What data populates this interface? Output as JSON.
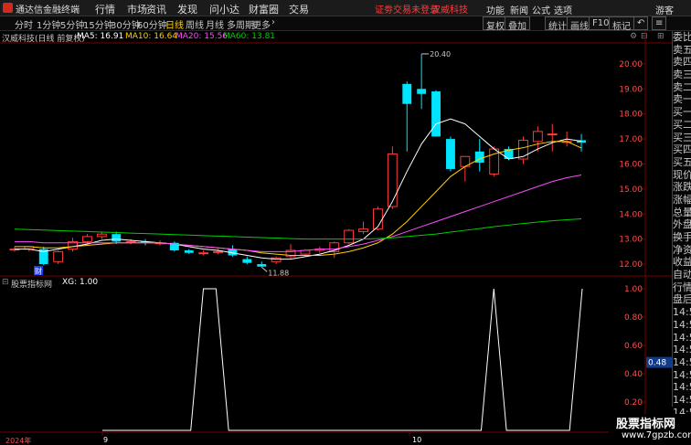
{
  "menubar": {
    "app_title": "通达信金融终端",
    "items": [
      "行情",
      "市场",
      "资讯",
      "发现",
      "问小达",
      "财富圈",
      "交易"
    ],
    "notice": "证劵交易未登录",
    "stock": "汉威科技",
    "right_items": [
      "功能",
      "新闻",
      "公式",
      "选项",
      "游客"
    ]
  },
  "periodbar": {
    "periods": [
      "分时",
      "1分钟",
      "5分钟",
      "15分钟",
      "30分钟",
      "60分钟",
      "日线",
      "周线",
      "月线",
      "多周期",
      "更多"
    ],
    "active": "日线",
    "tools": [
      "复权",
      "叠加",
      "统计",
      "画线",
      "F10",
      "标记"
    ]
  },
  "main_info": {
    "title": "汉威科技(日线 前复权)",
    "ma5": "MA5: 16.91",
    "ma10": "MA10: 16.64",
    "ma20": "MA20: 15.56",
    "ma60": "MA60: 13.81"
  },
  "sub_info": {
    "title": "股票指标网",
    "xg": "XG: 1.00"
  },
  "annotations": {
    "high": "20.40",
    "low": "11.88",
    "cai_badge": "财"
  },
  "dates": [
    "2024年",
    "9",
    "10"
  ],
  "right_panel": [
    "委比",
    "卖五",
    "卖四",
    "卖三",
    "卖二",
    "卖一",
    "买一",
    "买二",
    "买三",
    "买四",
    "买五",
    "现价",
    "涨跌",
    "涨幅",
    "总量",
    "外盘",
    "换手",
    "净资",
    "收益",
    "自动",
    "行情",
    "盘后",
    "14:5",
    "14:5",
    "14:5",
    "14:5",
    "14:5",
    "14:5",
    "14:5",
    "14:5",
    "14:5"
  ],
  "watermark": {
    "title": "股票指标网",
    "url": "www.7gpzb.com"
  },
  "colors": {
    "up": "#ff3b3b",
    "down": "#00e5ff",
    "ma5": "#ffffff",
    "ma10": "#ffd000",
    "ma20": "#ff4bff",
    "ma60": "#00d000"
  },
  "chart_data": [
    {
      "type": "candlestick",
      "title": "汉威科技(日线 前复权)",
      "y_ticks": [
        12.0,
        13.0,
        14.0,
        15.0,
        16.0,
        17.0,
        18.0,
        19.0,
        20.0
      ],
      "ylim": [
        11.6,
        20.8
      ],
      "candles": [
        {
          "o": 12.6,
          "h": 12.7,
          "l": 12.5,
          "c": 12.6
        },
        {
          "o": 12.6,
          "h": 12.7,
          "l": 12.5,
          "c": 12.7
        },
        {
          "o": 12.6,
          "h": 12.7,
          "l": 11.95,
          "c": 12.0
        },
        {
          "o": 12.1,
          "h": 12.55,
          "l": 12.0,
          "c": 12.5
        },
        {
          "o": 12.6,
          "h": 13.05,
          "l": 12.5,
          "c": 12.9
        },
        {
          "o": 12.9,
          "h": 13.2,
          "l": 12.8,
          "c": 13.1
        },
        {
          "o": 13.1,
          "h": 13.3,
          "l": 13.0,
          "c": 13.2
        },
        {
          "o": 13.2,
          "h": 13.3,
          "l": 12.8,
          "c": 12.9
        },
        {
          "o": 12.9,
          "h": 13.0,
          "l": 12.8,
          "c": 12.9
        },
        {
          "o": 12.9,
          "h": 13.0,
          "l": 12.75,
          "c": 12.85
        },
        {
          "o": 12.85,
          "h": 12.95,
          "l": 12.75,
          "c": 12.85
        },
        {
          "o": 12.85,
          "h": 12.9,
          "l": 12.5,
          "c": 12.55
        },
        {
          "o": 12.55,
          "h": 12.6,
          "l": 12.4,
          "c": 12.45
        },
        {
          "o": 12.45,
          "h": 12.55,
          "l": 12.35,
          "c": 12.45
        },
        {
          "o": 12.5,
          "h": 12.6,
          "l": 12.4,
          "c": 12.5
        },
        {
          "o": 12.6,
          "h": 12.75,
          "l": 12.3,
          "c": 12.35
        },
        {
          "o": 12.2,
          "h": 12.3,
          "l": 12.0,
          "c": 12.05
        },
        {
          "o": 12.0,
          "h": 12.1,
          "l": 11.88,
          "c": 11.9
        },
        {
          "o": 12.1,
          "h": 12.3,
          "l": 12.0,
          "c": 12.25
        },
        {
          "o": 12.3,
          "h": 12.8,
          "l": 12.2,
          "c": 12.55
        },
        {
          "o": 12.4,
          "h": 12.6,
          "l": 12.3,
          "c": 12.55
        },
        {
          "o": 12.55,
          "h": 12.7,
          "l": 12.45,
          "c": 12.6
        },
        {
          "o": 12.5,
          "h": 12.9,
          "l": 12.25,
          "c": 12.85
        },
        {
          "o": 12.85,
          "h": 13.4,
          "l": 12.8,
          "c": 13.35
        },
        {
          "o": 13.3,
          "h": 13.7,
          "l": 13.2,
          "c": 13.4
        },
        {
          "o": 13.4,
          "h": 14.3,
          "l": 13.35,
          "c": 14.2
        },
        {
          "o": 14.3,
          "h": 16.7,
          "l": 14.2,
          "c": 16.4
        },
        {
          "o": 19.2,
          "h": 19.3,
          "l": 16.5,
          "c": 18.4
        },
        {
          "o": 19.0,
          "h": 20.4,
          "l": 18.2,
          "c": 18.8
        },
        {
          "o": 18.9,
          "h": 18.95,
          "l": 17.1,
          "c": 17.1
        },
        {
          "o": 17.0,
          "h": 17.1,
          "l": 15.7,
          "c": 15.8
        },
        {
          "o": 15.9,
          "h": 16.3,
          "l": 15.3,
          "c": 16.3
        },
        {
          "o": 16.5,
          "h": 17.0,
          "l": 15.7,
          "c": 16.05
        },
        {
          "o": 15.6,
          "h": 16.7,
          "l": 15.5,
          "c": 16.6
        },
        {
          "o": 16.6,
          "h": 16.7,
          "l": 16.15,
          "c": 16.2
        },
        {
          "o": 16.2,
          "h": 17.1,
          "l": 16.0,
          "c": 16.95
        },
        {
          "o": 16.9,
          "h": 17.5,
          "l": 16.5,
          "c": 17.3
        },
        {
          "o": 17.2,
          "h": 17.6,
          "l": 16.5,
          "c": 17.2
        },
        {
          "o": 16.9,
          "h": 17.3,
          "l": 16.7,
          "c": 16.9
        },
        {
          "o": 16.95,
          "h": 17.2,
          "l": 16.5,
          "c": 16.85
        }
      ],
      "ma": [
        {
          "name": "MA5",
          "color": "#ffffff",
          "values": [
            12.6,
            12.6,
            12.5,
            12.6,
            12.7,
            12.8,
            12.95,
            13.0,
            12.95,
            12.9,
            12.85,
            12.8,
            12.7,
            12.6,
            12.55,
            12.45,
            12.35,
            12.25,
            12.2,
            12.2,
            12.3,
            12.4,
            12.55,
            12.75,
            13.0,
            13.5,
            14.5,
            15.7,
            16.8,
            17.6,
            17.8,
            17.6,
            17.1,
            16.6,
            16.2,
            16.3,
            16.6,
            16.85,
            17.0,
            16.91
          ]
        },
        {
          "name": "MA10",
          "color": "#ffd000",
          "values": [
            12.7,
            12.7,
            12.65,
            12.65,
            12.7,
            12.75,
            12.8,
            12.85,
            12.85,
            12.85,
            12.85,
            12.8,
            12.75,
            12.7,
            12.65,
            12.6,
            12.55,
            12.45,
            12.4,
            12.35,
            12.35,
            12.35,
            12.4,
            12.5,
            12.65,
            12.85,
            13.2,
            13.7,
            14.3,
            14.9,
            15.5,
            15.9,
            16.2,
            16.4,
            16.55,
            16.65,
            16.8,
            16.9,
            16.9,
            16.64
          ]
        },
        {
          "name": "MA20",
          "color": "#ff4bff",
          "values": [
            12.9,
            12.9,
            12.85,
            12.85,
            12.85,
            12.85,
            12.85,
            12.85,
            12.85,
            12.85,
            12.85,
            12.8,
            12.75,
            12.7,
            12.65,
            12.6,
            12.55,
            12.5,
            12.5,
            12.5,
            12.55,
            12.6,
            12.6,
            12.7,
            12.8,
            12.95,
            13.1,
            13.3,
            13.5,
            13.7,
            13.9,
            14.1,
            14.3,
            14.5,
            14.7,
            14.9,
            15.1,
            15.3,
            15.45,
            15.56
          ]
        },
        {
          "name": "MA60",
          "color": "#00d000",
          "values": [
            13.4,
            13.38,
            13.36,
            13.34,
            13.32,
            13.3,
            13.28,
            13.26,
            13.24,
            13.22,
            13.2,
            13.18,
            13.16,
            13.14,
            13.12,
            13.1,
            13.08,
            13.06,
            13.04,
            13.02,
            13.0,
            13.0,
            13.0,
            13.0,
            13.0,
            13.02,
            13.05,
            13.1,
            13.15,
            13.2,
            13.28,
            13.35,
            13.42,
            13.5,
            13.56,
            13.62,
            13.68,
            13.73,
            13.77,
            13.81
          ]
        }
      ]
    },
    {
      "type": "line",
      "title": "股票指标网",
      "series": [
        {
          "name": "XG",
          "values": [
            0,
            0,
            0,
            0,
            0,
            0,
            0,
            0,
            1,
            1,
            0,
            0,
            0,
            0,
            0,
            0,
            0,
            0,
            0,
            0,
            0,
            0,
            0,
            0,
            0,
            0,
            0,
            0,
            0,
            0,
            0,
            1,
            0,
            0,
            0,
            0,
            0,
            0,
            1
          ]
        },
        {
          "name": "",
          "values": []
        }
      ],
      "y_ticks": [
        1.0,
        0.8,
        0.6,
        0.4,
        0.2,
        0.0
      ],
      "ylim": [
        0,
        1.0
      ],
      "marker": "0.48"
    }
  ]
}
